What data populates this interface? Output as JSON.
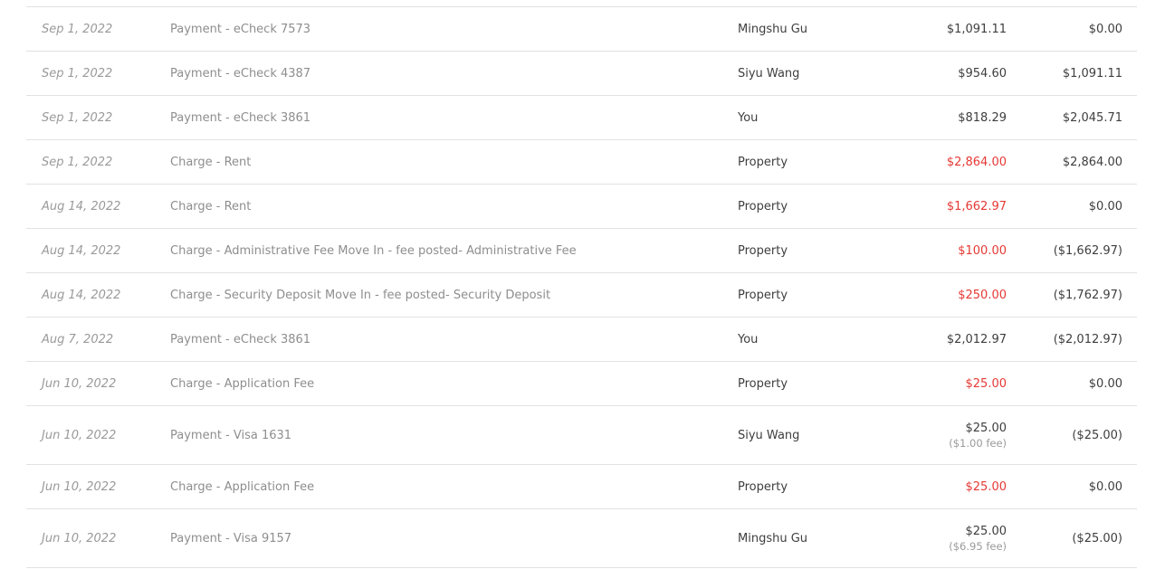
{
  "transactions": [
    {
      "date": "Sep 1, 2022",
      "description": "Payment - eCheck 7573",
      "party": "Mingshu Gu",
      "amount": "$1,091.11",
      "fee": "",
      "balance": "$0.00",
      "type": "payment"
    },
    {
      "date": "Sep 1, 2022",
      "description": "Payment - eCheck 4387",
      "party": "Siyu Wang",
      "amount": "$954.60",
      "fee": "",
      "balance": "$1,091.11",
      "type": "payment"
    },
    {
      "date": "Sep 1, 2022",
      "description": "Payment - eCheck 3861",
      "party": "You",
      "amount": "$818.29",
      "fee": "",
      "balance": "$2,045.71",
      "type": "payment"
    },
    {
      "date": "Sep 1, 2022",
      "description": "Charge - Rent",
      "party": "Property",
      "amount": "$2,864.00",
      "fee": "",
      "balance": "$2,864.00",
      "type": "charge"
    },
    {
      "date": "Aug 14, 2022",
      "description": "Charge - Rent",
      "party": "Property",
      "amount": "$1,662.97",
      "fee": "",
      "balance": "$0.00",
      "type": "charge"
    },
    {
      "date": "Aug 14, 2022",
      "description": "Charge - Administrative Fee Move In - fee posted- Administrative Fee",
      "party": "Property",
      "amount": "$100.00",
      "fee": "",
      "balance": "($1,662.97)",
      "type": "charge"
    },
    {
      "date": "Aug 14, 2022",
      "description": "Charge - Security Deposit Move In - fee posted- Security Deposit",
      "party": "Property",
      "amount": "$250.00",
      "fee": "",
      "balance": "($1,762.97)",
      "type": "charge"
    },
    {
      "date": "Aug 7, 2022",
      "description": "Payment - eCheck 3861",
      "party": "You",
      "amount": "$2,012.97",
      "fee": "",
      "balance": "($2,012.97)",
      "type": "payment"
    },
    {
      "date": "Jun 10, 2022",
      "description": "Charge - Application Fee",
      "party": "Property",
      "amount": "$25.00",
      "fee": "",
      "balance": "$0.00",
      "type": "charge"
    },
    {
      "date": "Jun 10, 2022",
      "description": "Payment - Visa 1631",
      "party": "Siyu Wang",
      "amount": "$25.00",
      "fee": "($1.00 fee)",
      "balance": "($25.00)",
      "type": "payment"
    },
    {
      "date": "Jun 10, 2022",
      "description": "Charge - Application Fee",
      "party": "Property",
      "amount": "$25.00",
      "fee": "",
      "balance": "$0.00",
      "type": "charge"
    },
    {
      "date": "Jun 10, 2022",
      "description": "Payment - Visa 9157",
      "party": "Mingshu Gu",
      "amount": "$25.00",
      "fee": "($6.95 fee)",
      "balance": "($25.00)",
      "type": "payment"
    }
  ],
  "colors": {
    "charge_amount": "#e53935",
    "text_dark": "#3e3e3e",
    "text_muted": "#8e8e8e",
    "divider": "#e2e2e2"
  }
}
